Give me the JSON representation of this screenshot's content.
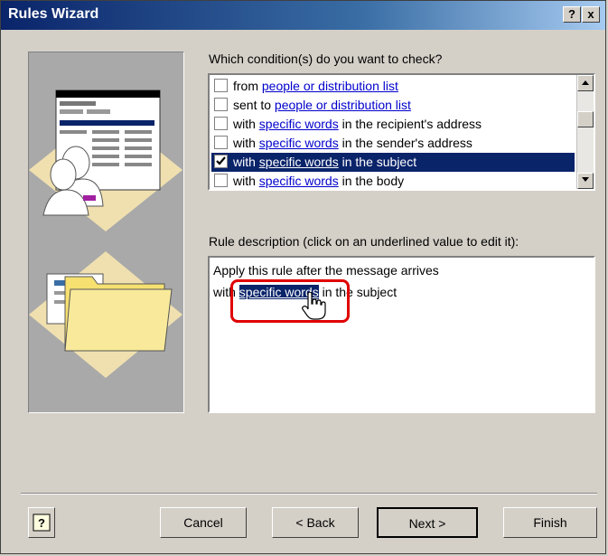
{
  "window": {
    "title": "Rules Wizard",
    "help_btn": "?",
    "close_btn": "x"
  },
  "conditions": {
    "prompt": "Which condition(s) do you want to check?",
    "items": [
      {
        "pre": "from ",
        "link": "people or distribution list",
        "post": "",
        "checked": false,
        "selected": false
      },
      {
        "pre": "sent to ",
        "link": "people or distribution list",
        "post": "",
        "checked": false,
        "selected": false
      },
      {
        "pre": "with ",
        "link": "specific words",
        "post": " in the recipient's address",
        "checked": false,
        "selected": false
      },
      {
        "pre": "with ",
        "link": "specific words",
        "post": " in the sender's address",
        "checked": false,
        "selected": false
      },
      {
        "pre": "with ",
        "link": "specific words",
        "post": " in the subject",
        "checked": true,
        "selected": true
      },
      {
        "pre": "with ",
        "link": "specific words",
        "post": " in the body",
        "checked": false,
        "selected": false
      }
    ]
  },
  "description": {
    "prompt": "Rule description (click on an underlined value to edit it):",
    "line1": "Apply this rule after the message arrives",
    "line2_pre": "with ",
    "line2_link": "specific words",
    "line2_post": " in the subject"
  },
  "buttons": {
    "help": "?",
    "cancel": "Cancel",
    "back": "< Back",
    "next": "Next >",
    "finish": "Finish"
  },
  "colors": {
    "titlebar": "#0a246a",
    "highlight": "#0a246a",
    "annotation": "#e00000",
    "link": "#0000cc"
  }
}
